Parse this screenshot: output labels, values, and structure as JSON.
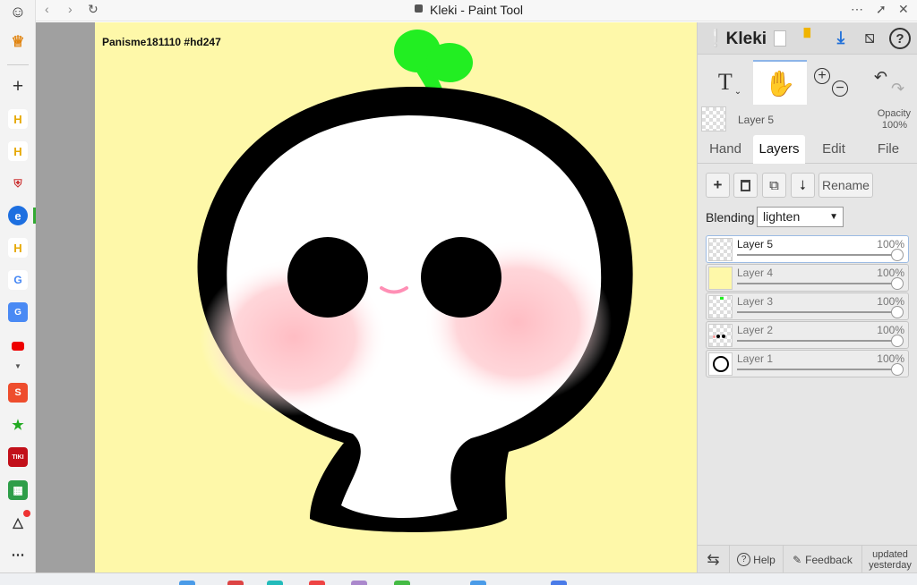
{
  "window": {
    "title": "Kleki - Paint Tool"
  },
  "canvas": {
    "stamp": "Panisme181110 #hd247",
    "background": "#fef8a9"
  },
  "panel": {
    "app_name": "Kleki",
    "current_layer": {
      "name": "Layer 5",
      "opacity_label": "Opacity",
      "opacity_value": "100%"
    },
    "tabs": [
      "Hand",
      "Layers",
      "Edit",
      "File"
    ],
    "active_tab": "Layers",
    "rename_label": "Rename",
    "blending": {
      "label": "Blending",
      "value": "lighten"
    },
    "layers": [
      {
        "name": "Layer 5",
        "opacity": "100%"
      },
      {
        "name": "Layer 4",
        "opacity": "100%"
      },
      {
        "name": "Layer 3",
        "opacity": "100%"
      },
      {
        "name": "Layer 2",
        "opacity": "100%"
      },
      {
        "name": "Layer 1",
        "opacity": "100%"
      }
    ],
    "footer": {
      "help": "Help",
      "feedback": "Feedback",
      "updated_line1": "updated",
      "updated_line2": "yesterday"
    }
  },
  "colors": {
    "accent": "#8cb4e8",
    "download": "#1e6fd9",
    "folder": "#f0b400",
    "leaf": "#22ee22"
  }
}
